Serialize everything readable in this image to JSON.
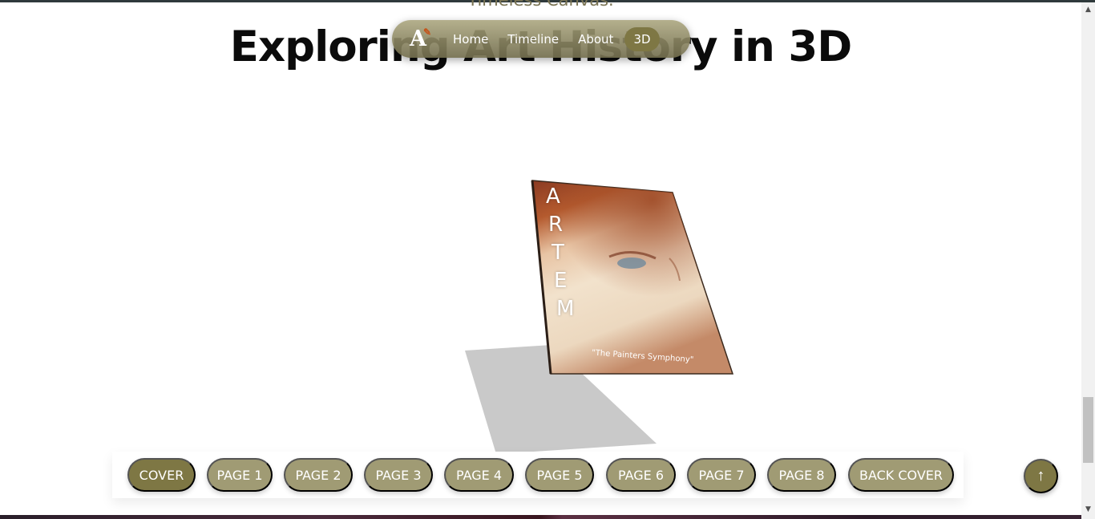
{
  "header": {
    "subtitle": "Timeless Canvas.",
    "title": "Exploring Art History in 3D"
  },
  "nav": {
    "logo": "A",
    "links": [
      {
        "label": "Home"
      },
      {
        "label": "Timeline"
      },
      {
        "label": "About"
      },
      {
        "label": "3D",
        "active": true
      }
    ]
  },
  "book": {
    "cover_letters": [
      "A",
      "R",
      "T",
      "E",
      "M"
    ],
    "caption": "\"The Painters Symphony\""
  },
  "pages": {
    "buttons": [
      {
        "label": "COVER",
        "active": true
      },
      {
        "label": "PAGE 1"
      },
      {
        "label": "PAGE 2"
      },
      {
        "label": "PAGE 3"
      },
      {
        "label": "PAGE 4"
      },
      {
        "label": "PAGE 5"
      },
      {
        "label": "PAGE 6"
      },
      {
        "label": "PAGE 7"
      },
      {
        "label": "PAGE 8"
      },
      {
        "label": "BACK COVER"
      }
    ]
  },
  "scroll_top": {
    "icon": "arrow-up-icon",
    "glyph": "↑"
  },
  "colors": {
    "accent": "#7e7744",
    "button": "#a09b74",
    "subtitle": "#7a7454"
  }
}
